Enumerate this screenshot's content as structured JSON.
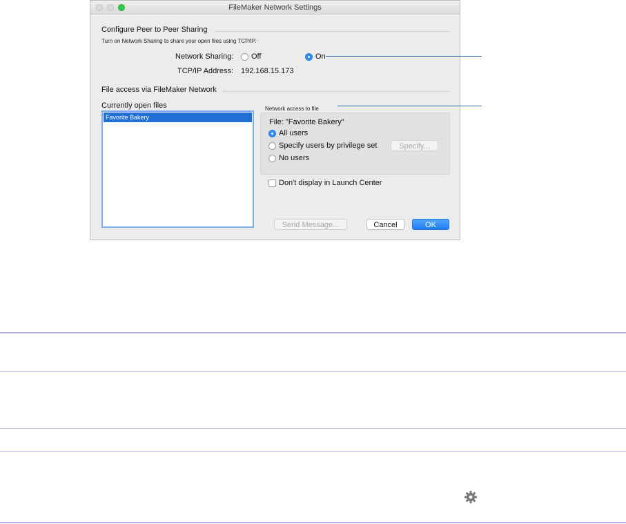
{
  "window": {
    "title": "FileMaker Network Settings"
  },
  "peer": {
    "section_title": "Configure Peer to Peer Sharing",
    "description": "Turn on Network Sharing to share your open files using TCP/IP.",
    "network_sharing_label": "Network Sharing:",
    "off_label": "Off",
    "on_label": "On",
    "selected": "On",
    "tcpip_label": "TCP/IP Address:",
    "tcpip_value": "192.168.15.173"
  },
  "file_access": {
    "section_title": "File access via FileMaker Network",
    "open_files_label": "Currently open files",
    "open_files": [
      "Favorite Bakery"
    ],
    "network_access_label": "Network access to file",
    "file_label": "File: \"Favorite Bakery\"",
    "options": [
      "All users",
      "Specify users by privilege set",
      "No users"
    ],
    "selected_option": "All users",
    "specify_button": "Specify...",
    "launch_center_label": "Don't display in Launch Center",
    "launch_center_checked": false
  },
  "buttons": {
    "send_message": "Send Message...",
    "cancel": "Cancel",
    "ok": "OK"
  },
  "icons": {
    "gear": "gear-icon"
  }
}
